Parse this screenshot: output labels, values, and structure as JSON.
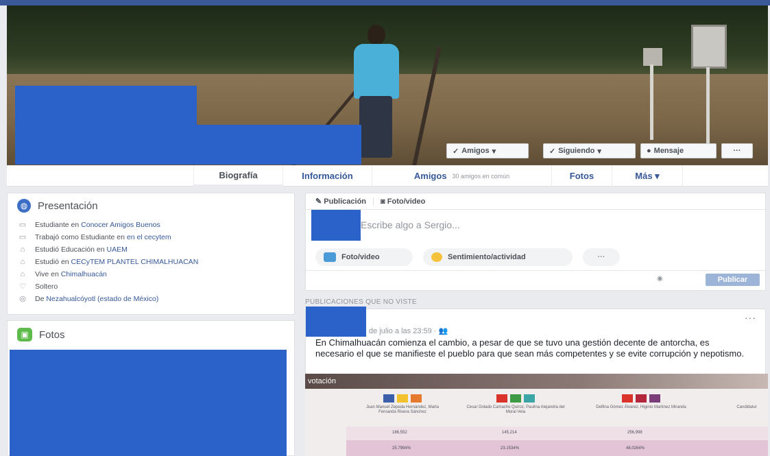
{
  "header_buttons": {
    "friends": "Amigos",
    "following": "Siguiendo",
    "message": "Mensaje",
    "more": "···"
  },
  "tabs": [
    {
      "label": "Biografía",
      "sub": ""
    },
    {
      "label": "Información",
      "sub": ""
    },
    {
      "label": "Amigos",
      "sub": "30 amigos en común"
    },
    {
      "label": "Fotos",
      "sub": ""
    },
    {
      "label": "Más ▾",
      "sub": ""
    }
  ],
  "intro": {
    "title": "Presentación",
    "items": [
      {
        "icon": "briefcase-icon",
        "text": "Estudiante en ",
        "link": "Conocer Amigos Buenos"
      },
      {
        "icon": "briefcase-icon",
        "text": "Trabajó como Estudiante en ",
        "link": "en el cecytem"
      },
      {
        "icon": "graduation-cap-icon",
        "text": "Estudió Educación en ",
        "link": "UAEM"
      },
      {
        "icon": "graduation-cap-icon",
        "text": "Estudió en ",
        "link": "CECyTEM PLANTEL CHIMALHUACAN"
      },
      {
        "icon": "home-icon",
        "text": "Vive en ",
        "link": "Chimalhuacán"
      },
      {
        "icon": "heart-icon",
        "text": "Soltero",
        "link": ""
      },
      {
        "icon": "location-pin-icon",
        "text": "De ",
        "link": "Nezahualcóyotl (estado de México)"
      }
    ]
  },
  "photos": {
    "title": "Fotos"
  },
  "composer": {
    "tab_post": "Publicación",
    "tab_photo": "Foto/video",
    "placeholder": "Escribe algo a Sergio...",
    "btn_photo": "Foto/video",
    "btn_feeling": "Sentimiento/actividad",
    "btn_more": "···",
    "publish": "Publicar"
  },
  "feed": {
    "section_header": "PUBLICACIONES QUE NO VISTE",
    "post": {
      "meta": "de julio a las 23:59 · ",
      "more": "···",
      "text": "En Chimalhuacán comienza el cambio, a pesar de que se tuvo una gestión decente de antorcha, es necesario el que se manifieste el pueblo para que sean más competentes y se evite corrupción y nepotismo.",
      "image": {
        "header": "votación",
        "candidates": [
          "Juan Manuel Zepeda Hernández, Marta Fernanda Rivera Sánchez",
          "Cesar Dolado Camacho Quiroz, Paulina Alejandra del Moral Vela",
          "Delfina Gómez Álvarez, Higinio Martínez Miranda",
          "Candidatur"
        ],
        "votes": [
          "186,552",
          "145,214",
          "256,998",
          ""
        ],
        "percents": [
          "25.7994%",
          "23.1534%",
          "48.0264%",
          ""
        ]
      }
    }
  }
}
